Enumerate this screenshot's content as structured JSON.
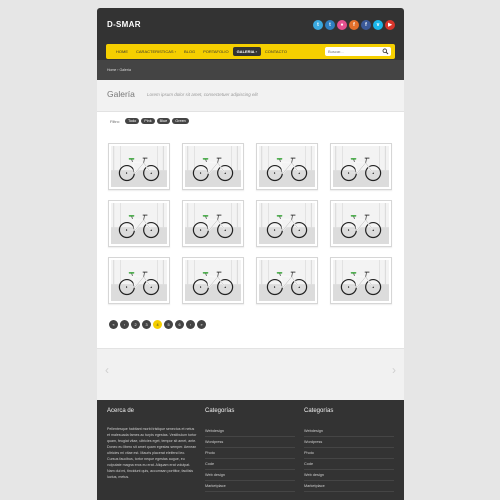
{
  "brand": {
    "logo": "D-SMAR"
  },
  "social": [
    {
      "icon": "twitter-icon",
      "glyph": "t",
      "color": "#3aa9e0"
    },
    {
      "icon": "twitter-icon",
      "glyph": "t",
      "color": "#2f7fc1"
    },
    {
      "icon": "dribbble-icon",
      "glyph": "●",
      "color": "#e5508f"
    },
    {
      "icon": "flickr-icon",
      "glyph": "f",
      "color": "#e36f2a"
    },
    {
      "icon": "facebook-icon",
      "glyph": "f",
      "color": "#3b5998"
    },
    {
      "icon": "vimeo-icon",
      "glyph": "v",
      "color": "#1ab7ea"
    },
    {
      "icon": "youtube-icon",
      "glyph": "▶",
      "color": "#d8352b"
    }
  ],
  "nav": {
    "items": [
      "HOME",
      "CARACTERISTICAS ›",
      "BLOG",
      "PORTAFOLIO",
      "GALERIA ›",
      "CONTACTO"
    ],
    "active_index": 4
  },
  "search": {
    "placeholder": "Buscar..."
  },
  "breadcrumb": {
    "text": "Home  ›  Galería"
  },
  "page": {
    "title": "Galería",
    "subtitle": "Lorem ipsum dolor sit amet, consectetuer adipiscing elit"
  },
  "filters": {
    "label": "Filtro:",
    "options": [
      "Todo",
      "Pink",
      "Blue",
      "Green"
    ]
  },
  "gallery": {
    "count": 12
  },
  "pagination": {
    "items": [
      "«",
      "‹",
      "2",
      "3",
      "4",
      "5",
      "6",
      "›",
      "»"
    ],
    "active_index": 4
  },
  "slider": {
    "prev": "‹",
    "next": "›"
  },
  "footer": {
    "about": {
      "title": "Acerca de",
      "text": "Pellentesque habitant morbi tristique senectus et netus et malesuada fames ac turpis egestas. Vestibulum tortor quam, feugiat vitae, ultricies eget, tempor sit amet, ante. Donec eu libero sit amet quam egestas semper. Aenean ultricies mi vitae est. Mauris placerat eleifend leo. Cursus faucibus, tortor neque egestas augue, eu vulputate magna eros eu erat. Aliquam erat volutpat. Nam dui mi, tincidunt quis, accumsan porttitor, facilisis luctus, metus."
    },
    "col2": {
      "title": "Categorías",
      "links": [
        "Webdesign",
        "Wordpress",
        "Photo",
        "Code",
        "Web design",
        "Marketplace"
      ]
    },
    "col3": {
      "title": "Categorías",
      "links": [
        "Webdesign",
        "Wordpress",
        "Photo",
        "Code",
        "Web design",
        "Marketplace"
      ]
    }
  }
}
